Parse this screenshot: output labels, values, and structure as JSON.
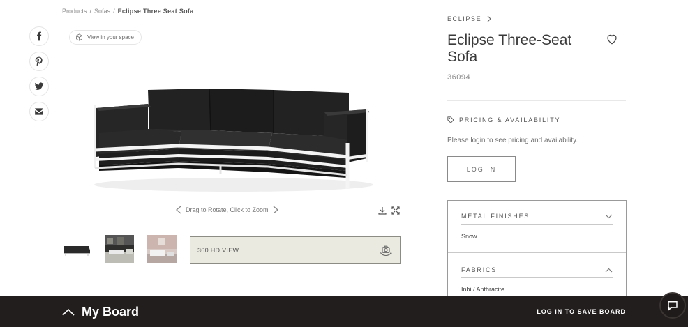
{
  "breadcrumb": {
    "items": [
      "Products",
      "Sofas",
      "Eclipse Three Seat Sofa"
    ],
    "separator": "/"
  },
  "share": {
    "icons": [
      "facebook-icon",
      "pinterest-icon",
      "twitter-icon",
      "email-icon"
    ]
  },
  "viewer": {
    "view_in_space": "View in your space",
    "rotate_hint": "Drag to Rotate, Click to Zoom",
    "hd_view_label": "360 HD VIEW"
  },
  "product": {
    "brand": "ECLIPSE",
    "title": "Eclipse Three-Seat Sofa",
    "sku": "36094"
  },
  "pricing": {
    "heading": "PRICING & AVAILABILITY",
    "note": "Please login to see pricing and availability.",
    "login_label": "LOG IN"
  },
  "options": {
    "metal_finishes": {
      "label": "METAL FINISHES",
      "value": "Snow"
    },
    "fabrics": {
      "label": "FABRICS",
      "value": "Inbi / Anthracite"
    }
  },
  "footer": {
    "board_label": "My Board",
    "save_label": "LOG IN TO SAVE BOARD"
  },
  "colors": {
    "footer_bg": "#221e1d",
    "hd_button_bg": "#ebeae0",
    "sofa_fabric": "#1e1e1e",
    "sofa_frame": "#f4f4f4"
  }
}
